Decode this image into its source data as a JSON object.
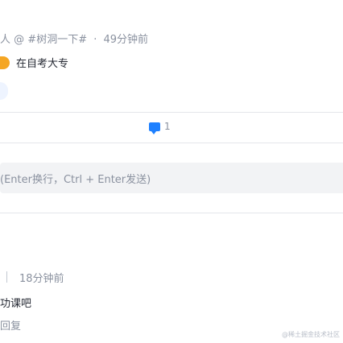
{
  "post": {
    "meta": {
      "author_fragment": "人",
      "at": "@",
      "topic": "#树洞一下#",
      "separator": "·",
      "time": "49分钟前"
    },
    "content": "在自考大专"
  },
  "actions": {
    "comment_count": "1"
  },
  "comment_input": {
    "placeholder": "(Enter换行，Ctrl + Enter发送)"
  },
  "reply": {
    "time": "18分钟前",
    "text": "功课吧",
    "action_label": "回复"
  },
  "watermark": "@稀土掘金技术社区",
  "colors": {
    "accent": "#1e80ff",
    "muted_text": "#8a919f",
    "main_text": "#252933",
    "input_bg": "#f2f3f5"
  }
}
